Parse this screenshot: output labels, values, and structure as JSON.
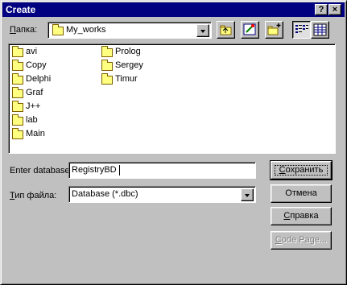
{
  "window": {
    "title": "Create"
  },
  "titlebar": {
    "help_label": "?",
    "close_label": "×"
  },
  "location": {
    "label": "Папка:",
    "accesskey": "П",
    "label_rest": "апка:",
    "value": "My_works"
  },
  "toolbar": [
    "up-one-level-icon",
    "open-database-icon",
    "create-new-folder-icon",
    "list-view-icon",
    "details-view-icon"
  ],
  "folders": {
    "column1": [
      "avi",
      "Copy",
      "Delphi",
      "Graf",
      "J++",
      "lab",
      "Main"
    ],
    "column2": [
      "Prolog",
      "Sergey",
      "Timur"
    ]
  },
  "name_field": {
    "label": "Enter database",
    "value": "RegistryBD"
  },
  "type_field": {
    "label_accesskey": "Т",
    "label_rest": "ип файла:",
    "value": "Database (*.dbc)"
  },
  "buttons": {
    "save": {
      "accesskey": "С",
      "rest": "охранить"
    },
    "cancel": {
      "label": "Отмена"
    },
    "help": {
      "accesskey": "С",
      "rest": "правка"
    },
    "code_page": {
      "accesskey": "C",
      "rest": "ode Page..."
    }
  },
  "colors": {
    "face": "#c0c0c0",
    "titlebar": "#000080",
    "folder": "#ffff80"
  }
}
